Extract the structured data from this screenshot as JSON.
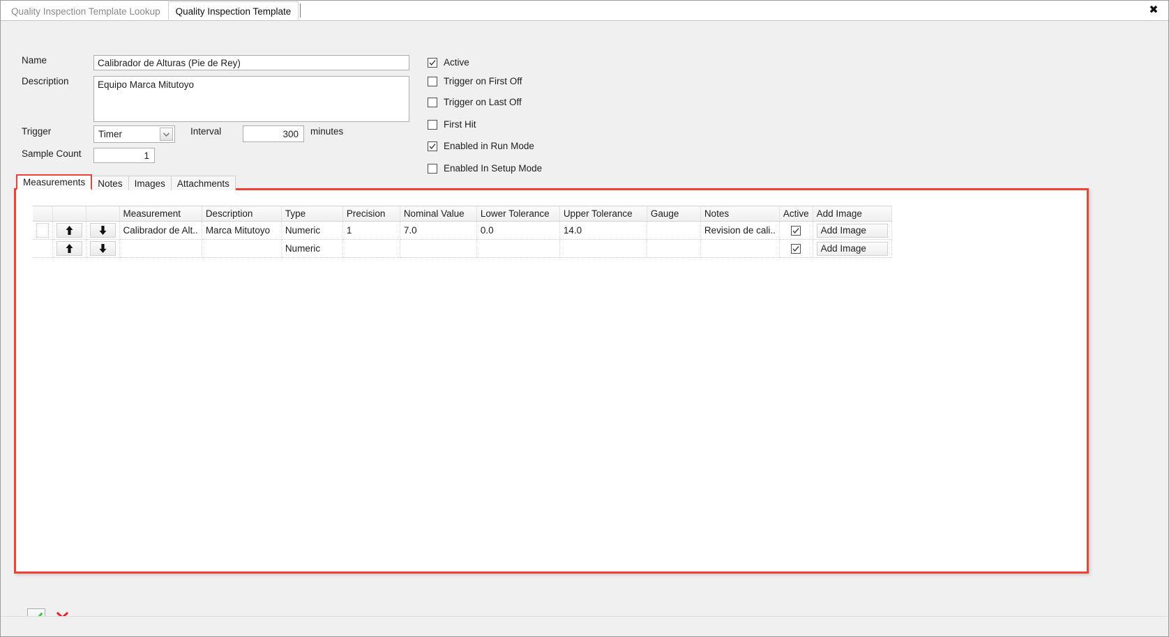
{
  "window": {
    "tabs": [
      {
        "label": "Quality Inspection Template Lookup",
        "active": false
      },
      {
        "label": "Quality Inspection Template",
        "active": true
      }
    ],
    "close_label": "✖"
  },
  "form": {
    "name_label": "Name",
    "name_value": "Calibrador de Alturas (Pie de Rey)",
    "description_label": "Description",
    "description_value": "Equipo Marca Mitutoyo",
    "trigger_label": "Trigger",
    "trigger_value": "Timer",
    "interval_label": "Interval",
    "interval_value": "300",
    "interval_units": "minutes",
    "sample_count_label": "Sample Count",
    "sample_count_value": "1"
  },
  "options": [
    {
      "label": "Active",
      "checked": true
    },
    {
      "label": "Trigger on First Off",
      "checked": false
    },
    {
      "label": "Trigger on Last Off",
      "checked": false
    },
    {
      "label": "First Hit",
      "checked": false
    },
    {
      "label": "Enabled in Run Mode",
      "checked": true
    },
    {
      "label": "Enabled In Setup Mode",
      "checked": false
    }
  ],
  "inner_tabs": [
    {
      "label": "Measurements",
      "active": true
    },
    {
      "label": "Notes",
      "active": false
    },
    {
      "label": "Images",
      "active": false
    },
    {
      "label": "Attachments",
      "active": false
    }
  ],
  "grid": {
    "columns": [
      "Measurement",
      "Description",
      "Type",
      "Precision",
      "Nominal Value",
      "Lower Tolerance",
      "Upper Tolerance",
      "Gauge",
      "Notes",
      "Active",
      "Add Image"
    ],
    "move_up_icon": "arrow-up-icon",
    "move_down_icon": "arrow-down-icon",
    "add_image_label": "Add Image",
    "rows": [
      {
        "measurement": "Calibrador de Alt..",
        "description": "Marca Mitutoyo",
        "type": "Numeric",
        "precision": "1",
        "nominal_value": "7.0",
        "lower_tolerance": "0.0",
        "upper_tolerance": "14.0",
        "gauge": "",
        "notes": "Revision de cali..",
        "active": true,
        "add_image": "Add Image",
        "selected": true
      },
      {
        "measurement": "",
        "description": "",
        "type": "Numeric",
        "precision": "",
        "nominal_value": "",
        "lower_tolerance": "",
        "upper_tolerance": "",
        "gauge": "",
        "notes": "",
        "active": true,
        "add_image": "Add Image",
        "selected": false
      }
    ]
  },
  "commands": {
    "ok_icon": "check-icon",
    "cancel_icon": "x-icon"
  },
  "colors": {
    "accent_red": "#ef4136",
    "ok_green": "#2ecc40",
    "cancel_red": "#e8251f",
    "window_bg": "#f0f0f0"
  }
}
